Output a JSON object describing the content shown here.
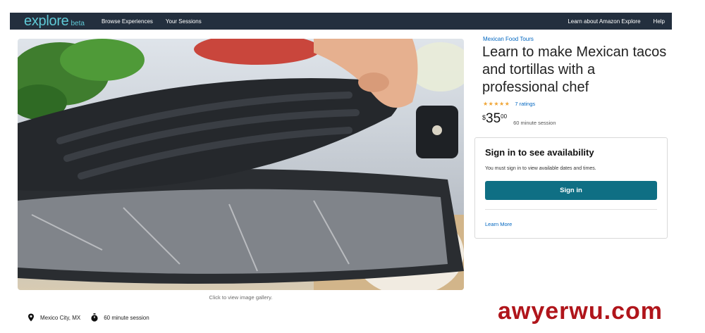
{
  "nav": {
    "brand": "explore",
    "brand_badge": "beta",
    "links_left": [
      "Browse Experiences",
      "Your Sessions"
    ],
    "links_right": [
      "Learn about Amazon Explore",
      "Help"
    ]
  },
  "hero": {
    "caption": "Click to view image gallery."
  },
  "meta": {
    "location": "Mexico City, MX",
    "session": "60 minute session"
  },
  "listing": {
    "category": "Mexican Food Tours",
    "title": "Learn to make Mexican tacos and tortillas with a professional chef",
    "rating_stars": 5,
    "ratings_text": "7 ratings",
    "price_symbol": "$",
    "price_whole": "35",
    "price_fraction": "00",
    "session_length": "60 minute session"
  },
  "signin_card": {
    "title": "Sign in to see availability",
    "subtitle": "You must sign in to view available dates and times.",
    "button_label": "Sign in",
    "learn_more": "Learn More"
  },
  "watermark": "awyerwu.com",
  "colors": {
    "nav_bg": "#232f3e",
    "brand": "#5fc9d6",
    "link": "#0066c0",
    "button": "#0f6f84",
    "star": "#f0a534",
    "watermark": "#b0151b"
  }
}
